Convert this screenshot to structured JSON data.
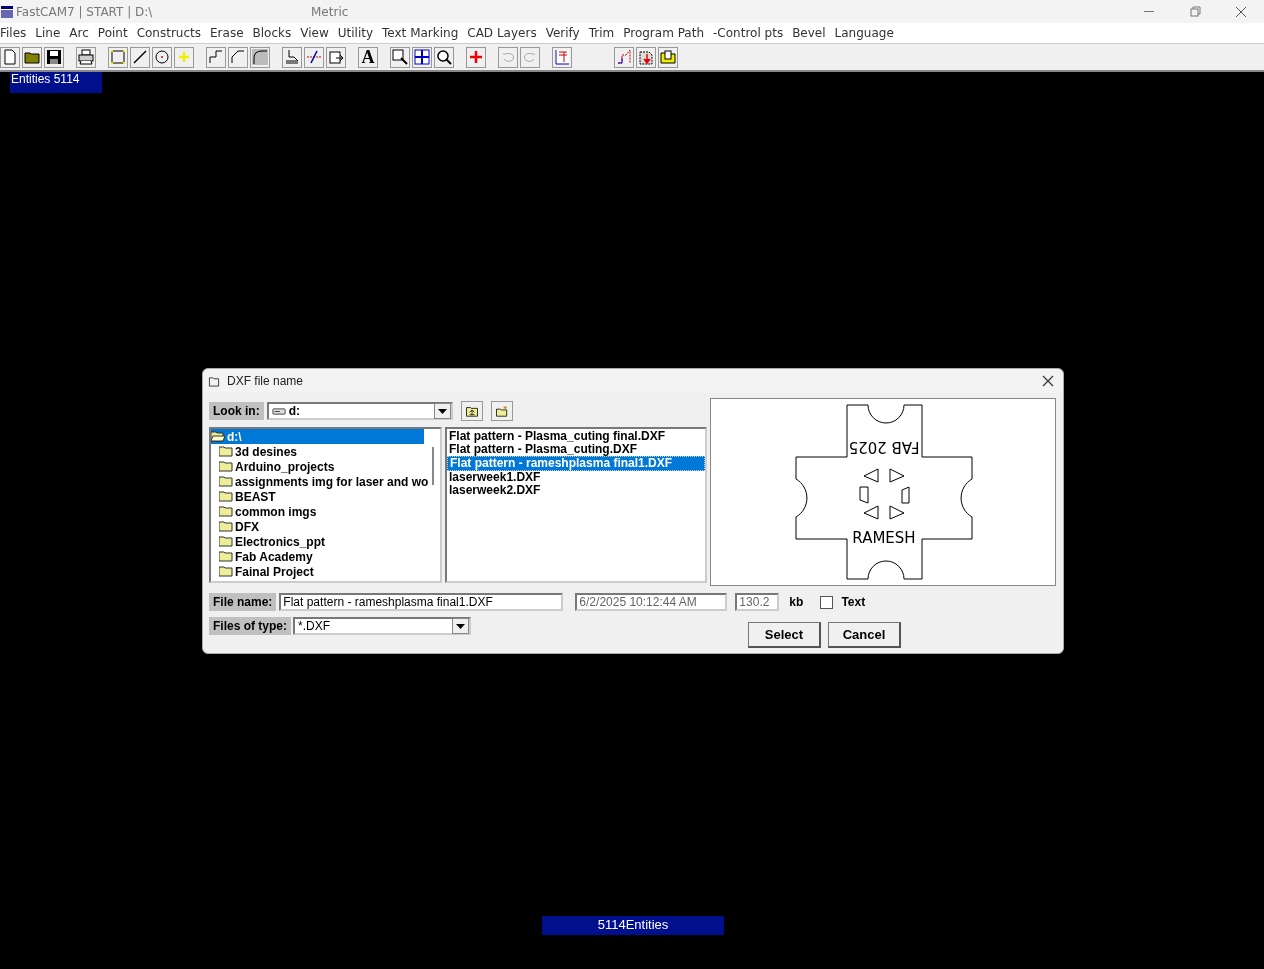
{
  "window": {
    "title": "FastCAM7  |  START  |  D:\\",
    "units": "Metric"
  },
  "menu": [
    "Files",
    "Line",
    "Arc",
    "Point",
    "Constructs",
    "Erase",
    "Blocks",
    "View",
    "Utility",
    "Text Marking",
    "CAD Layers",
    "Verify",
    "Trim",
    "Program Path",
    "-Control pts",
    "Bevel",
    "Language"
  ],
  "toolbar_text_glyph": "A",
  "canvas": {
    "entities_top": "Entities  5114",
    "entities_bottom": "5114Entities"
  },
  "dialog": {
    "title": "DXF file name",
    "look_in": {
      "label": "Look in:",
      "value": "d:"
    },
    "folders": [
      {
        "name": "d:\\",
        "selected": true,
        "expanded": true,
        "children": [
          {
            "name": "3d desines",
            "selected": false
          },
          {
            "name": "Arduino_projects",
            "selected": false
          },
          {
            "name": "assignments img for laser and wo",
            "selected": false
          },
          {
            "name": "BEAST",
            "selected": false
          },
          {
            "name": "common imgs",
            "selected": false
          },
          {
            "name": "DFX",
            "selected": false
          },
          {
            "name": "Electronics_ppt",
            "selected": false
          },
          {
            "name": "Fab Academy",
            "selected": false
          },
          {
            "name": "Fainal Project",
            "selected": false
          }
        ]
      }
    ],
    "files": [
      {
        "name": "Flat pattern - Plasma_cuting final.DXF",
        "selected": false
      },
      {
        "name": "Flat pattern - Plasma_cuting.DXF",
        "selected": false
      },
      {
        "name": "Flat pattern - rameshplasma final1.DXF",
        "selected": true
      },
      {
        "name": "laserweek1.DXF",
        "selected": false
      },
      {
        "name": "laserweek2.DXF",
        "selected": false
      }
    ],
    "preview": {
      "top_text": "FAB 2025",
      "bottom_text": "RAMESH"
    },
    "file_name": {
      "label": "File name:",
      "value": "Flat pattern - rameshplasma final1.DXF"
    },
    "date": "6/2/2025 10:12:44 AM",
    "size": "130.2",
    "size_unit": "kb",
    "text_option": {
      "label": "Text",
      "checked": false
    },
    "file_type": {
      "label": "Files of type:",
      "value": "*.DXF"
    },
    "buttons": [
      "Select",
      "Cancel"
    ]
  }
}
